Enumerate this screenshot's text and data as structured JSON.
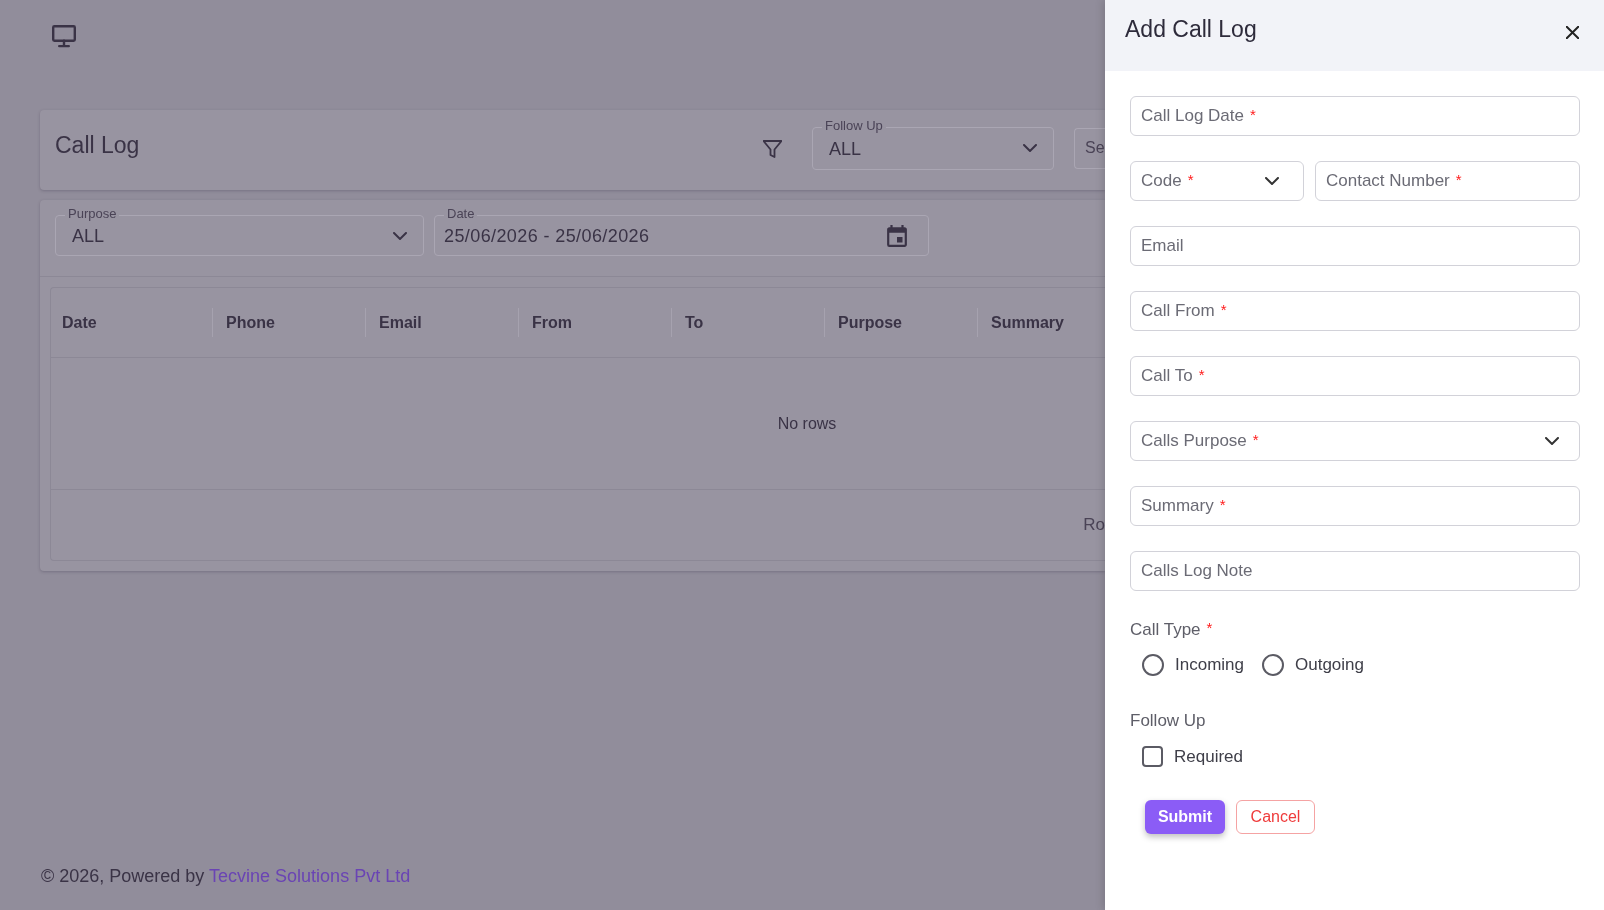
{
  "header": {
    "title": "Call Log",
    "follow_up": {
      "label": "Follow Up",
      "value": "ALL"
    },
    "partial_field": {
      "placeholder": "Se"
    }
  },
  "filters": {
    "purpose": {
      "label": "Purpose",
      "value": "ALL"
    },
    "date": {
      "label": "Date",
      "value": "25/06/2026 - 25/06/2026"
    }
  },
  "table": {
    "columns": [
      "Date",
      "Phone",
      "Email",
      "From",
      "To",
      "Purpose",
      "Summary"
    ],
    "empty_message": "No rows",
    "footer_text": "Ro"
  },
  "footer": {
    "text": "© 2026, Powered by",
    "link": "Tecvine Solutions Pvt Ltd"
  },
  "drawer": {
    "title": "Add Call Log",
    "field_rows": [
      {
        "fields": [
          {
            "kind": "text",
            "placeholder": "Call Log Date",
            "required_mark": "*"
          }
        ]
      },
      {
        "fields": [
          {
            "kind": "select",
            "placeholder": "Code",
            "required_mark": "*"
          },
          {
            "kind": "text",
            "placeholder": "Contact Number",
            "required_mark": "*"
          }
        ]
      },
      {
        "fields": [
          {
            "kind": "text",
            "placeholder": "Email"
          }
        ]
      },
      {
        "fields": [
          {
            "kind": "text",
            "placeholder": "Call From",
            "required_mark": "*"
          }
        ]
      },
      {
        "fields": [
          {
            "kind": "text",
            "placeholder": "Call To",
            "required_mark": "*"
          }
        ]
      },
      {
        "fields": [
          {
            "kind": "select",
            "placeholder": "Calls Purpose",
            "required_mark": "*"
          }
        ]
      },
      {
        "fields": [
          {
            "kind": "text",
            "placeholder": "Summary",
            "required_mark": "*"
          }
        ]
      },
      {
        "fields": [
          {
            "kind": "text",
            "placeholder": "Calls Log Note"
          }
        ]
      }
    ],
    "call_type": {
      "label": "Call Type",
      "required_mark": "*",
      "options": [
        {
          "label": "Incoming",
          "selected": false
        },
        {
          "label": "Outgoing",
          "selected": false
        }
      ]
    },
    "follow_up": {
      "label": "Follow Up",
      "options": [
        {
          "label": "Required",
          "checked": false
        }
      ]
    },
    "buttons": [
      {
        "label": "Submit",
        "kind": "primary"
      },
      {
        "label": "Cancel",
        "kind": "secondary"
      }
    ]
  }
}
